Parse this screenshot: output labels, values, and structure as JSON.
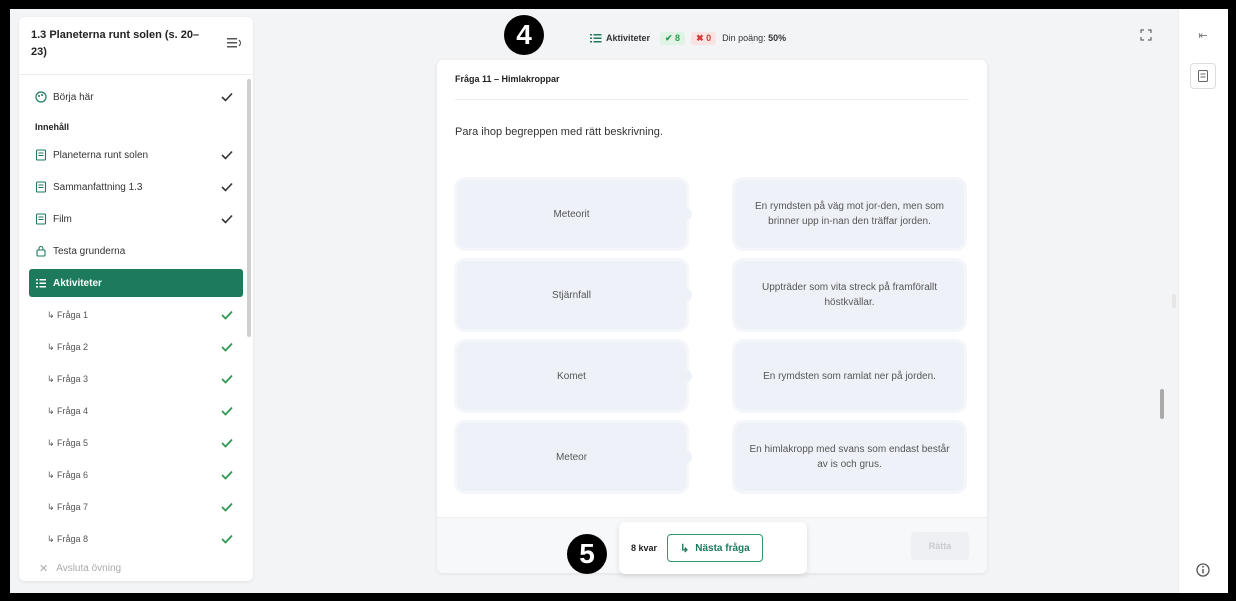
{
  "sidebar": {
    "title": "1.3 Planeterna runt solen (s. 20–23)",
    "start": {
      "label": "Börja här",
      "done": true
    },
    "section_label": "Innehåll",
    "items": [
      {
        "label": "Planeterna runt solen",
        "done": true,
        "icon": "document-icon"
      },
      {
        "label": "Sammanfattning 1.3",
        "done": true,
        "icon": "document-icon"
      },
      {
        "label": "Film",
        "done": true,
        "icon": "document-icon"
      },
      {
        "label": "Testa grunderna",
        "done": false,
        "icon": "lock-icon"
      },
      {
        "label": "Aktiviteter",
        "active": true,
        "icon": "list-icon"
      }
    ],
    "questions": [
      "Fråga 1",
      "Fråga 2",
      "Fråga 3",
      "Fråga 4",
      "Fråga 5",
      "Fråga 6",
      "Fråga 7",
      "Fråga 8"
    ],
    "exit_label": "Avsluta övning"
  },
  "topbar": {
    "activity_label": "Aktiviteter",
    "correct": "✔ 8",
    "wrong": "✖ 0",
    "score_label": "Din poäng:",
    "score_value": "50%"
  },
  "badges": {
    "top": "4",
    "bottom": "5"
  },
  "card": {
    "title": "Fråga 11 – Himlakroppar",
    "instruction": "Para ihop begreppen med rätt beskrivning.",
    "left_terms": [
      "Meteorit",
      "Stjärnfall",
      "Komet",
      "Meteor"
    ],
    "right_descriptions": [
      "En rymdsten på väg mot jor-den, men som brinner upp in-nan den träffar jorden.",
      "Uppträder som vita streck på framförallt höstkvällar.",
      "En rymdsten som ramlat ner på jorden.",
      "En himlakropp med svans som endast består av is och grus."
    ],
    "check_label": "Rätta"
  },
  "footer": {
    "remaining": "8 kvar",
    "next_label": "Nästa fråga"
  },
  "colors": {
    "accent": "#1d7a5c",
    "check": "#2e9a4f",
    "wrong": "#d23b3b"
  }
}
